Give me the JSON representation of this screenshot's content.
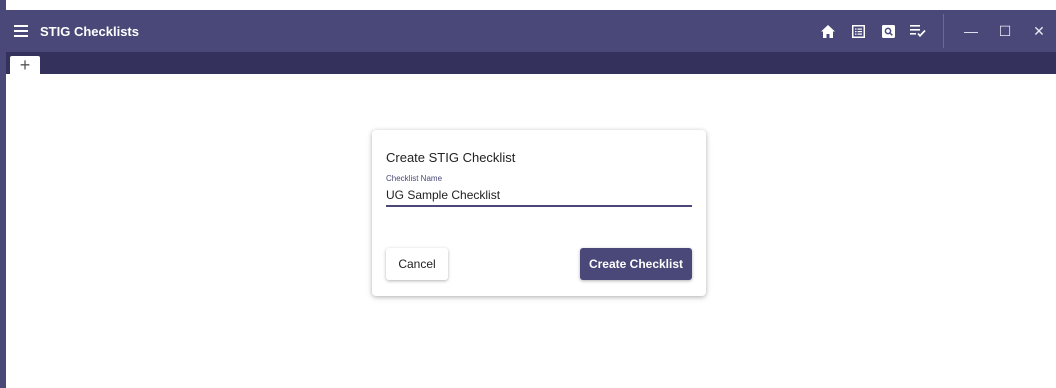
{
  "window": {
    "title": "STIG Checklists",
    "minimize_glyph": "—",
    "maximize_glyph": "☐",
    "close_glyph": "✕"
  },
  "toolbar": {
    "icons": [
      "home-icon",
      "document-list-icon",
      "search-document-icon",
      "checklist-icon"
    ]
  },
  "tabs": {
    "add_label": "+"
  },
  "dialog": {
    "title": "Create STIG Checklist",
    "field_label": "Checklist Name",
    "field_value": "UG Sample Checklist",
    "cancel_label": "Cancel",
    "create_label": "Create Checklist"
  },
  "colors": {
    "primary": "#4a4878",
    "tabbar": "#34325c"
  }
}
